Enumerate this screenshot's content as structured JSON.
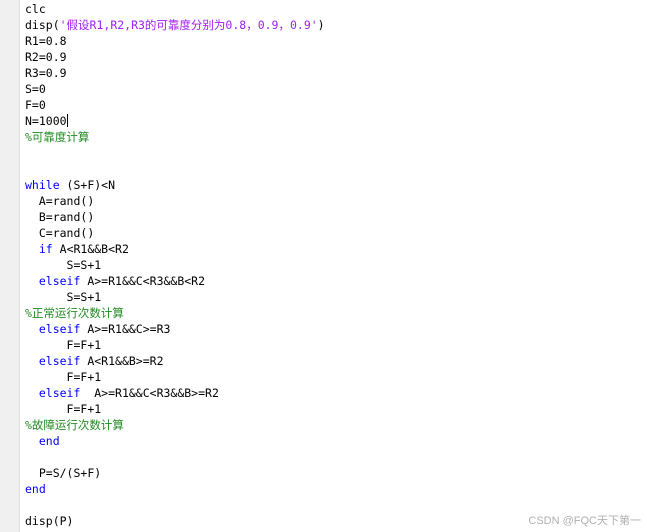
{
  "editor": {
    "lines": [
      {
        "indent": "",
        "segments": [
          {
            "t": "plain",
            "v": "clc"
          }
        ]
      },
      {
        "indent": "",
        "segments": [
          {
            "t": "plain",
            "v": "disp("
          },
          {
            "t": "str",
            "v": "'假设R1,R2,R3的可靠度分别为0.8，0.9，0.9'"
          },
          {
            "t": "plain",
            "v": ")"
          }
        ]
      },
      {
        "indent": "",
        "segments": [
          {
            "t": "plain",
            "v": "R1=0.8"
          }
        ]
      },
      {
        "indent": "",
        "segments": [
          {
            "t": "plain",
            "v": "R2=0.9"
          }
        ]
      },
      {
        "indent": "",
        "segments": [
          {
            "t": "plain",
            "v": "R3=0.9"
          }
        ]
      },
      {
        "indent": "",
        "segments": [
          {
            "t": "plain",
            "v": "S=0"
          }
        ]
      },
      {
        "indent": "",
        "segments": [
          {
            "t": "plain",
            "v": "F=0"
          }
        ]
      },
      {
        "indent": "",
        "segments": [
          {
            "t": "plain",
            "v": "N=1000"
          }
        ],
        "caret": true
      },
      {
        "indent": "",
        "segments": [
          {
            "t": "cmt",
            "v": "%可靠度计算"
          }
        ]
      },
      {
        "indent": "",
        "segments": []
      },
      {
        "indent": "",
        "segments": []
      },
      {
        "indent": "",
        "segments": [
          {
            "t": "kw",
            "v": "while"
          },
          {
            "t": "plain",
            "v": " (S+F)<N"
          }
        ]
      },
      {
        "indent": "  ",
        "segments": [
          {
            "t": "plain",
            "v": "A=rand()"
          }
        ]
      },
      {
        "indent": "  ",
        "segments": [
          {
            "t": "plain",
            "v": "B=rand()"
          }
        ]
      },
      {
        "indent": "  ",
        "segments": [
          {
            "t": "plain",
            "v": "C=rand()"
          }
        ]
      },
      {
        "indent": "  ",
        "segments": [
          {
            "t": "kw",
            "v": "if"
          },
          {
            "t": "plain",
            "v": " A<R1&&B<R2"
          }
        ]
      },
      {
        "indent": "      ",
        "segments": [
          {
            "t": "plain",
            "v": "S=S+1"
          }
        ]
      },
      {
        "indent": "  ",
        "segments": [
          {
            "t": "kw",
            "v": "elseif"
          },
          {
            "t": "plain",
            "v": " A>=R1&&C<R3&&B<R2"
          }
        ]
      },
      {
        "indent": "      ",
        "segments": [
          {
            "t": "plain",
            "v": "S=S+1"
          }
        ]
      },
      {
        "indent": "",
        "segments": [
          {
            "t": "cmt",
            "v": "%正常运行次数计算"
          }
        ]
      },
      {
        "indent": "  ",
        "segments": [
          {
            "t": "kw",
            "v": "elseif"
          },
          {
            "t": "plain",
            "v": " A>=R1&&C>=R3"
          }
        ]
      },
      {
        "indent": "      ",
        "segments": [
          {
            "t": "plain",
            "v": "F=F+1"
          }
        ]
      },
      {
        "indent": "  ",
        "segments": [
          {
            "t": "kw",
            "v": "elseif"
          },
          {
            "t": "plain",
            "v": " A<R1&&B>=R2"
          }
        ]
      },
      {
        "indent": "      ",
        "segments": [
          {
            "t": "plain",
            "v": "F=F+1"
          }
        ]
      },
      {
        "indent": "  ",
        "segments": [
          {
            "t": "kw",
            "v": "elseif"
          },
          {
            "t": "plain",
            "v": "  A>=R1&&C<R3&&B>=R2"
          }
        ]
      },
      {
        "indent": "      ",
        "segments": [
          {
            "t": "plain",
            "v": "F=F+1"
          }
        ]
      },
      {
        "indent": "",
        "segments": [
          {
            "t": "cmt",
            "v": "%故障运行次数计算"
          }
        ]
      },
      {
        "indent": "  ",
        "segments": [
          {
            "t": "kw",
            "v": "end"
          }
        ]
      },
      {
        "indent": "",
        "segments": []
      },
      {
        "indent": "  ",
        "segments": [
          {
            "t": "plain",
            "v": "P=S/(S+F)"
          }
        ]
      },
      {
        "indent": "",
        "segments": [
          {
            "t": "kw",
            "v": "end"
          }
        ]
      },
      {
        "indent": "",
        "segments": []
      },
      {
        "indent": "",
        "segments": [
          {
            "t": "plain",
            "v": "disp(P)"
          }
        ]
      }
    ]
  },
  "watermark": "CSDN @FQC天下第一",
  "colors": {
    "keyword": "#0000ff",
    "string": "#a020f0",
    "comment": "#228b22",
    "text": "#000000",
    "background": "#ffffff"
  }
}
